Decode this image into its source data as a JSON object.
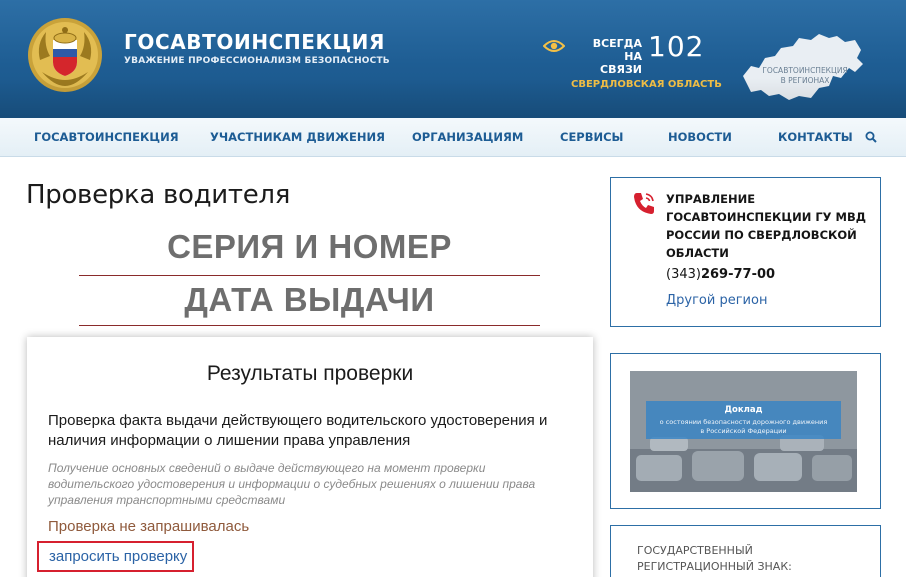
{
  "header": {
    "brand_title": "ГОСАВТОИНСПЕКЦИЯ",
    "brand_subtitle": "УВАЖЕНИЕ ПРОФЕССИОНАЛИЗМ БЕЗОПАСНОСТЬ",
    "always_line1": "ВСЕГДА",
    "always_line2": "НА СВЯЗИ",
    "hotline": "102",
    "region": "СВЕРДЛОВСКАЯ ОБЛАСТЬ",
    "map_label_line1": "ГОСАВТОИНСПЕКЦИЯ",
    "map_label_line2": "В РЕГИОНАХ",
    "colors": {
      "header_blue": "#1e5d93",
      "accent_gold": "#f3c046"
    }
  },
  "nav": {
    "items": [
      {
        "label": "ГОСАВТОИНСПЕКЦИЯ"
      },
      {
        "label": "УЧАСТНИКАМ ДВИЖЕНИЯ"
      },
      {
        "label": "ОРГАНИЗАЦИЯМ"
      },
      {
        "label": "СЕРВИСЫ"
      },
      {
        "label": "НОВОСТИ"
      },
      {
        "label": "КОНТАКТЫ"
      }
    ],
    "search_icon": "search-icon"
  },
  "main": {
    "page_title": "Проверка водителя",
    "field_series": "СЕРИЯ И НОМЕР",
    "field_date": "ДАТА ВЫДАЧИ",
    "results": {
      "title": "Результаты проверки",
      "description": "Проверка факта выдачи действующего водительского удостоверения и наличия информации о лишении права управления",
      "note": "Получение основных сведений о выдаче действующего на момент проверки водительского удостоверения и информации о судебных решениях о лишении права управления транспортными средствами",
      "status": "Проверка не запрашивалась",
      "request_link": "запросить проверку"
    }
  },
  "sidebar": {
    "contact": {
      "title": "УПРАВЛЕНИЕ ГОСАВТОИНСПЕКЦИИ ГУ МВД РОССИИ ПО СВЕРДЛОВСКОЙ ОБЛАСТИ",
      "phone_code": "(343)",
      "phone_number": "269-77-00",
      "other_region": "Другой регион"
    },
    "report": {
      "title": "Доклад",
      "subtitle_line1": "о состоянии безопасности дорожного движения",
      "subtitle_line2": "в Российской Федерации"
    },
    "plate": {
      "title_line1": "ГОСУДАРСТВЕННЫЙ",
      "title_line2": "РЕГИСТРАЦИОННЫЙ ЗНАК:"
    }
  }
}
